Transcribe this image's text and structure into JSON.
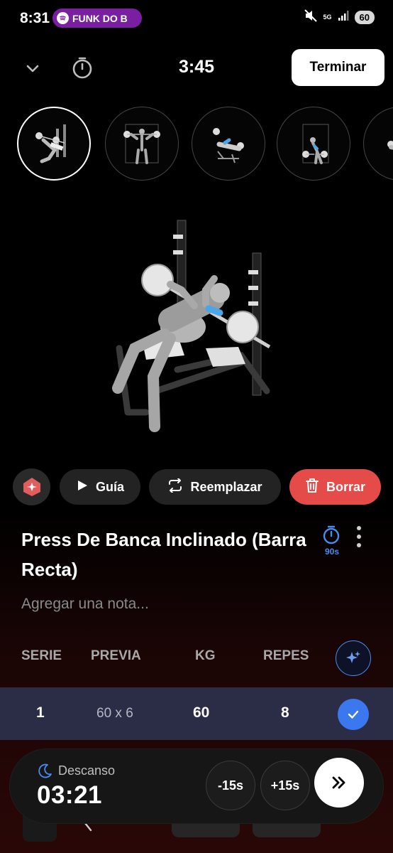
{
  "status_bar": {
    "time": "8:31",
    "media_pill": "FUNK DO B",
    "network": "5G",
    "battery": "60",
    "colors": {
      "pill": "#7a1fa2"
    }
  },
  "header": {
    "timer_display": "3:45",
    "finish_label": "Terminar",
    "icons": [
      "chevron-down-icon",
      "stopwatch-icon"
    ]
  },
  "exercise_thumbnails": [
    {
      "name": "Press De Banca Inclinado (Barra Recta)",
      "active": true
    },
    {
      "name": "thumb-2",
      "active": false
    },
    {
      "name": "thumb-3",
      "active": false
    },
    {
      "name": "thumb-4",
      "active": false
    },
    {
      "name": "thumb-5",
      "active": false
    }
  ],
  "actions": {
    "guide_label": "Guía",
    "replace_label": "Reemplazar",
    "delete_label": "Borrar",
    "colors": {
      "delete": "#e54b49",
      "pill": "#232323"
    }
  },
  "exercise": {
    "title": "Press De Banca Inclinado (Barra Recta)",
    "rest_timer": "90s",
    "note_placeholder": "Agregar una nota..."
  },
  "set_table": {
    "columns": [
      "SERIE",
      "PREVIA",
      "KG",
      "REPES"
    ],
    "rows": [
      {
        "serie": "1",
        "previa": "60 x 6",
        "kg": "60",
        "repes": "8",
        "completed": true
      }
    ]
  },
  "rest_timer_bar": {
    "label": "Descanso",
    "time": "03:21",
    "minus_label": "-15s",
    "plus_label": "+15s",
    "accent": "#3b78f0"
  }
}
